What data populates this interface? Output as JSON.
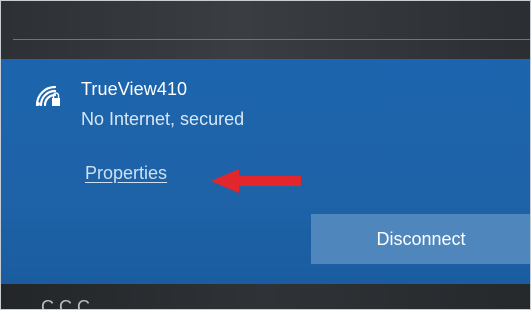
{
  "network": {
    "icon": "wifi-secured-icon",
    "name": "TrueView410",
    "status": "No Internet, secured"
  },
  "links": {
    "properties_label": "Properties"
  },
  "buttons": {
    "disconnect_label": "Disconnect"
  },
  "annotation": {
    "icon": "red-arrow-icon",
    "color": "#e3262b"
  },
  "next_network": {
    "icon": "wifi-icon",
    "partial_name": "C    C    C"
  },
  "colors": {
    "panel": "#1c64ad",
    "button": "#4f87bd",
    "top_strip": "#2d3034"
  }
}
